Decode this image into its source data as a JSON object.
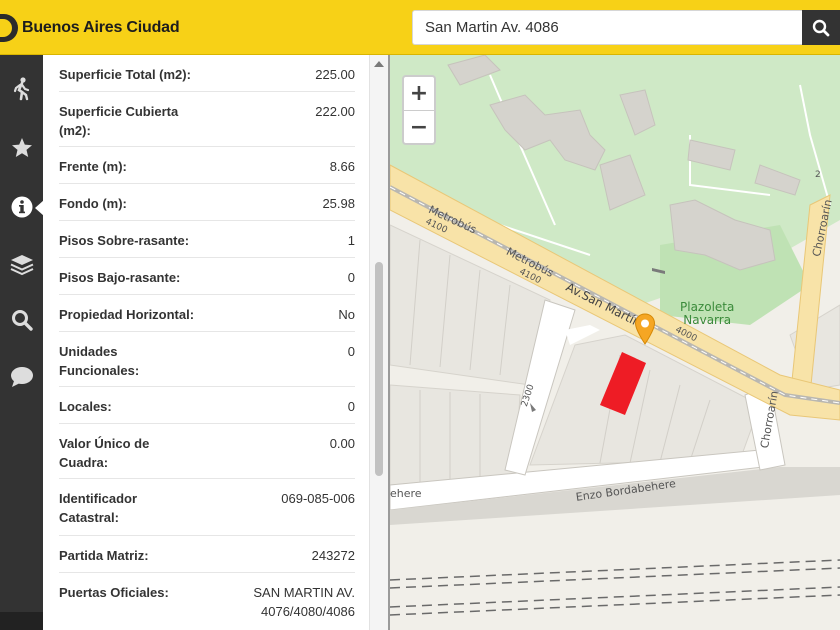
{
  "header": {
    "brand": "Buenos Aires Ciudad",
    "search_value": "San Martin Av. 4086",
    "search_icon": "search-icon",
    "accent_color": "#f7d117"
  },
  "rail": {
    "items": [
      {
        "icon": "walking-person-icon",
        "active": false
      },
      {
        "icon": "star-icon",
        "active": false
      },
      {
        "icon": "info-icon",
        "active": true
      },
      {
        "icon": "layers-icon",
        "active": false
      },
      {
        "icon": "search-icon",
        "active": false
      },
      {
        "icon": "chat-bubble-icon",
        "active": false
      }
    ]
  },
  "parcel_info": {
    "rows": [
      {
        "label": "Superficie Total (m2):",
        "value": "225.00"
      },
      {
        "label": "Superficie Cubierta (m2):",
        "value": "222.00"
      },
      {
        "label": "Frente (m):",
        "value": "8.66"
      },
      {
        "label": "Fondo (m):",
        "value": "25.98"
      },
      {
        "label": "Pisos Sobre-rasante:",
        "value": "1"
      },
      {
        "label": "Pisos Bajo-rasante:",
        "value": "0"
      },
      {
        "label": "Propiedad Horizontal:",
        "value": "No"
      },
      {
        "label": "Unidades Funcionales:",
        "value": "0"
      },
      {
        "label": "Locales:",
        "value": "0"
      },
      {
        "label": "Valor Único de Cuadra:",
        "value": "0.00"
      },
      {
        "label": "Identificador Catastral:",
        "value": "069-085-006"
      },
      {
        "label": "Partida Matriz:",
        "value": "243272"
      },
      {
        "label": "Puertas Oficiales:",
        "value": "SAN MARTIN AV. 4076/4080/4086"
      }
    ]
  },
  "map": {
    "zoom_in": "+",
    "zoom_out": "−",
    "labels": {
      "metrobus_1": "Metrobús",
      "metrobus_2": "Metrobús",
      "num_4100_a": "4100",
      "num_4100_b": "4100",
      "av_san_martin": "Av.San Martín",
      "num_4000": "4000",
      "chorroarin_1": "Chorroarín",
      "chorroarin_2": "Chorroarín",
      "num_2": "2",
      "num_2300": "2300",
      "enzo": "Enzo Bordabehere",
      "ehere": "ehere",
      "plazoleta": "Plazoleta",
      "navarra": "Navarra"
    },
    "highlight_color": "#ee1c25",
    "pin_color": "#f5a623"
  }
}
